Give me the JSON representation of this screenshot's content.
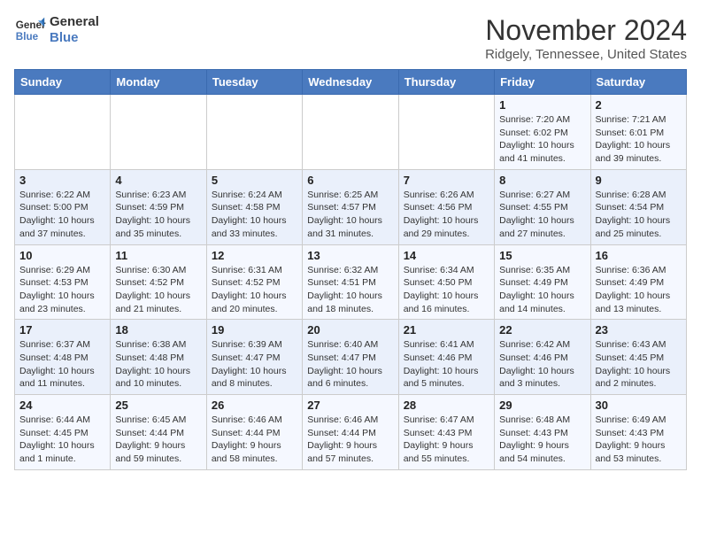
{
  "header": {
    "logo_line1": "General",
    "logo_line2": "Blue",
    "month": "November 2024",
    "location": "Ridgely, Tennessee, United States"
  },
  "days_of_week": [
    "Sunday",
    "Monday",
    "Tuesday",
    "Wednesday",
    "Thursday",
    "Friday",
    "Saturday"
  ],
  "weeks": [
    [
      {
        "day": "",
        "info": ""
      },
      {
        "day": "",
        "info": ""
      },
      {
        "day": "",
        "info": ""
      },
      {
        "day": "",
        "info": ""
      },
      {
        "day": "",
        "info": ""
      },
      {
        "day": "1",
        "info": "Sunrise: 7:20 AM\nSunset: 6:02 PM\nDaylight: 10 hours and 41 minutes."
      },
      {
        "day": "2",
        "info": "Sunrise: 7:21 AM\nSunset: 6:01 PM\nDaylight: 10 hours and 39 minutes."
      }
    ],
    [
      {
        "day": "3",
        "info": "Sunrise: 6:22 AM\nSunset: 5:00 PM\nDaylight: 10 hours and 37 minutes."
      },
      {
        "day": "4",
        "info": "Sunrise: 6:23 AM\nSunset: 4:59 PM\nDaylight: 10 hours and 35 minutes."
      },
      {
        "day": "5",
        "info": "Sunrise: 6:24 AM\nSunset: 4:58 PM\nDaylight: 10 hours and 33 minutes."
      },
      {
        "day": "6",
        "info": "Sunrise: 6:25 AM\nSunset: 4:57 PM\nDaylight: 10 hours and 31 minutes."
      },
      {
        "day": "7",
        "info": "Sunrise: 6:26 AM\nSunset: 4:56 PM\nDaylight: 10 hours and 29 minutes."
      },
      {
        "day": "8",
        "info": "Sunrise: 6:27 AM\nSunset: 4:55 PM\nDaylight: 10 hours and 27 minutes."
      },
      {
        "day": "9",
        "info": "Sunrise: 6:28 AM\nSunset: 4:54 PM\nDaylight: 10 hours and 25 minutes."
      }
    ],
    [
      {
        "day": "10",
        "info": "Sunrise: 6:29 AM\nSunset: 4:53 PM\nDaylight: 10 hours and 23 minutes."
      },
      {
        "day": "11",
        "info": "Sunrise: 6:30 AM\nSunset: 4:52 PM\nDaylight: 10 hours and 21 minutes."
      },
      {
        "day": "12",
        "info": "Sunrise: 6:31 AM\nSunset: 4:52 PM\nDaylight: 10 hours and 20 minutes."
      },
      {
        "day": "13",
        "info": "Sunrise: 6:32 AM\nSunset: 4:51 PM\nDaylight: 10 hours and 18 minutes."
      },
      {
        "day": "14",
        "info": "Sunrise: 6:34 AM\nSunset: 4:50 PM\nDaylight: 10 hours and 16 minutes."
      },
      {
        "day": "15",
        "info": "Sunrise: 6:35 AM\nSunset: 4:49 PM\nDaylight: 10 hours and 14 minutes."
      },
      {
        "day": "16",
        "info": "Sunrise: 6:36 AM\nSunset: 4:49 PM\nDaylight: 10 hours and 13 minutes."
      }
    ],
    [
      {
        "day": "17",
        "info": "Sunrise: 6:37 AM\nSunset: 4:48 PM\nDaylight: 10 hours and 11 minutes."
      },
      {
        "day": "18",
        "info": "Sunrise: 6:38 AM\nSunset: 4:48 PM\nDaylight: 10 hours and 10 minutes."
      },
      {
        "day": "19",
        "info": "Sunrise: 6:39 AM\nSunset: 4:47 PM\nDaylight: 10 hours and 8 minutes."
      },
      {
        "day": "20",
        "info": "Sunrise: 6:40 AM\nSunset: 4:47 PM\nDaylight: 10 hours and 6 minutes."
      },
      {
        "day": "21",
        "info": "Sunrise: 6:41 AM\nSunset: 4:46 PM\nDaylight: 10 hours and 5 minutes."
      },
      {
        "day": "22",
        "info": "Sunrise: 6:42 AM\nSunset: 4:46 PM\nDaylight: 10 hours and 3 minutes."
      },
      {
        "day": "23",
        "info": "Sunrise: 6:43 AM\nSunset: 4:45 PM\nDaylight: 10 hours and 2 minutes."
      }
    ],
    [
      {
        "day": "24",
        "info": "Sunrise: 6:44 AM\nSunset: 4:45 PM\nDaylight: 10 hours and 1 minute."
      },
      {
        "day": "25",
        "info": "Sunrise: 6:45 AM\nSunset: 4:44 PM\nDaylight: 9 hours and 59 minutes."
      },
      {
        "day": "26",
        "info": "Sunrise: 6:46 AM\nSunset: 4:44 PM\nDaylight: 9 hours and 58 minutes."
      },
      {
        "day": "27",
        "info": "Sunrise: 6:46 AM\nSunset: 4:44 PM\nDaylight: 9 hours and 57 minutes."
      },
      {
        "day": "28",
        "info": "Sunrise: 6:47 AM\nSunset: 4:43 PM\nDaylight: 9 hours and 55 minutes."
      },
      {
        "day": "29",
        "info": "Sunrise: 6:48 AM\nSunset: 4:43 PM\nDaylight: 9 hours and 54 minutes."
      },
      {
        "day": "30",
        "info": "Sunrise: 6:49 AM\nSunset: 4:43 PM\nDaylight: 9 hours and 53 minutes."
      }
    ]
  ]
}
